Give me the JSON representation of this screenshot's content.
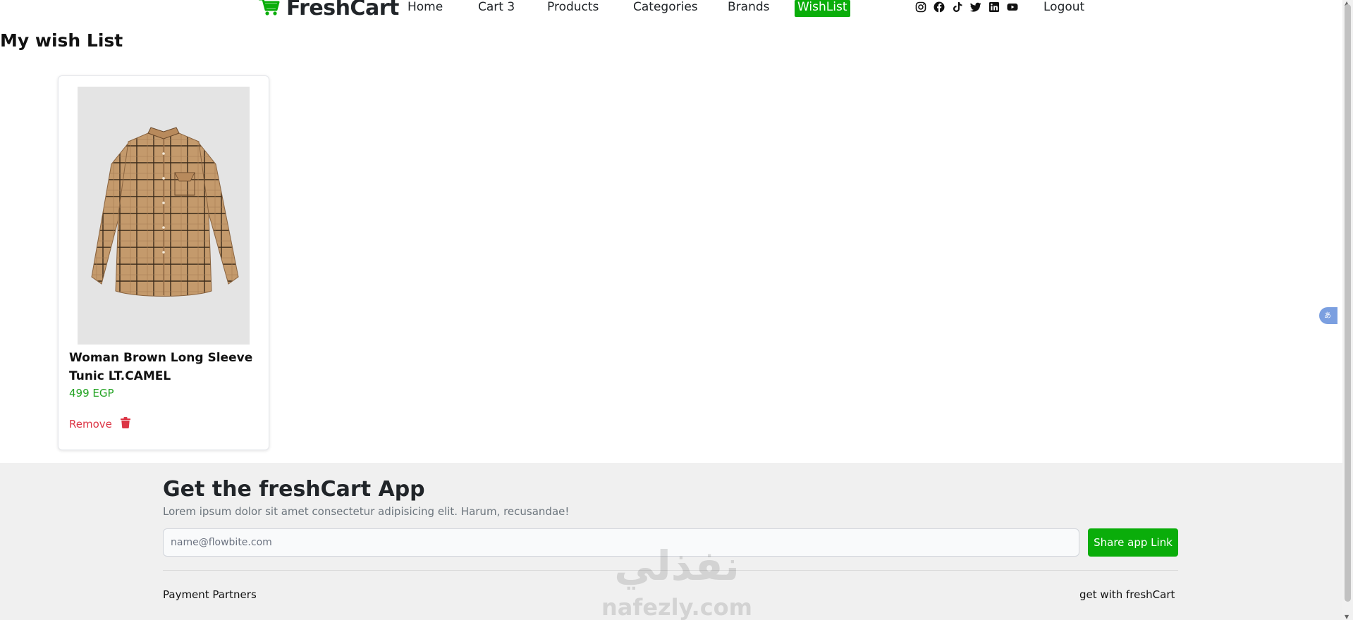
{
  "brand": {
    "name": "FreshCart",
    "accent_color": "#0aad0a",
    "logo_icon": "cart-icon"
  },
  "nav": {
    "links": [
      {
        "label": "Home"
      },
      {
        "label": "Cart 3"
      },
      {
        "label": "Products"
      },
      {
        "label": "Categories"
      },
      {
        "label": "Brands"
      },
      {
        "label": "WishList",
        "active": true
      }
    ],
    "socials": [
      "instagram-icon",
      "facebook-icon",
      "tiktok-icon",
      "twitter-icon",
      "linkedin-icon",
      "youtube-icon"
    ],
    "logout_label": "Logout"
  },
  "page": {
    "title": "My wish List"
  },
  "wishlist": {
    "items": [
      {
        "title": "Woman Brown Long Sleeve Tunic LT.CAMEL",
        "price": "499 EGP",
        "remove_label": "Remove",
        "image_icon": "shirt-image"
      }
    ]
  },
  "footer": {
    "title": "Get the freshCart App",
    "subtitle": "Lorem ipsum dolor sit amet consectetur adipisicing elit. Harum, recusandae!",
    "email_placeholder": "name@flowbite.com",
    "share_label": "Share app Link",
    "payment_label": "Payment Partners",
    "get_label": "get with freshCart"
  },
  "watermark": {
    "arabic": "نفذلي",
    "latin": "nafezly.com"
  }
}
